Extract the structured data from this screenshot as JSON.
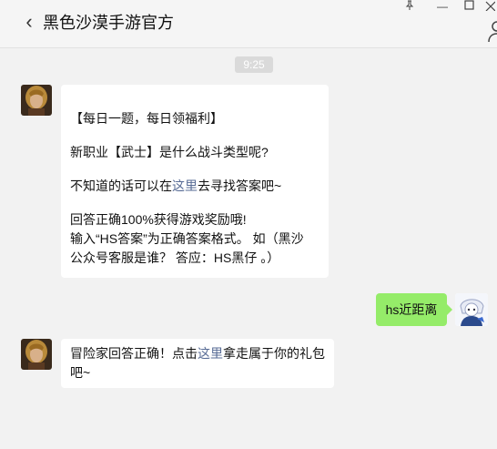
{
  "header": {
    "back_icon": "chevron-left-icon",
    "title": "黑色沙漠手游官方",
    "window_controls": [
      "pin-icon",
      "minimize-icon",
      "maximize-icon",
      "close-icon"
    ],
    "profile_icon": "person-icon"
  },
  "chat": {
    "timestamp": "9:25",
    "messages": [
      {
        "sender": "bot",
        "lines": {
          "l1": "【每日一题，每日领福利】",
          "l2": "新职业【武士】是什么战斗类型呢?",
          "l3_pre": "不知道的话可以在",
          "l3_link": "这里",
          "l3_post": "去寻找答案吧~",
          "l4": "回答正确100%获得游戏奖励哦!",
          "l5": "输入“HS答案”为正确答案格式。 如（黑沙",
          "l6": "公众号客服是谁？ 答应：HS黑仔 。）"
        }
      },
      {
        "sender": "user",
        "text": "hs近距离"
      },
      {
        "sender": "bot",
        "text_pre": "冒险家回答正确！点击",
        "link": "这里",
        "text_post": "拿走属于你的礼包吧~"
      }
    ]
  },
  "colors": {
    "background": "#f2f2f2",
    "bubble_bot": "#ffffff",
    "bubble_user": "#95ec69",
    "link": "#576b95",
    "timestamp_bg": "#dadada"
  }
}
